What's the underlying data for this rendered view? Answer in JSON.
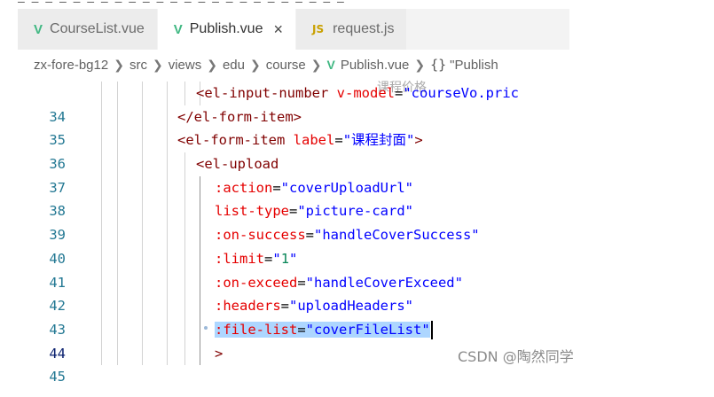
{
  "tabs": [
    {
      "icon": "V",
      "label": "CourseList.vue"
    },
    {
      "icon": "V",
      "label": "Publish.vue",
      "close": "×"
    },
    {
      "icon": "JS",
      "label": "request.js"
    }
  ],
  "breadcrumb": {
    "items": [
      "zx-fore-bg12",
      "src",
      "views",
      "edu",
      "course"
    ],
    "file_icon": "V",
    "file": "Publish.vue",
    "symbol_icon": "{}",
    "symbol": "\"Publish"
  },
  "ghost_text": "课程价格",
  "code": {
    "line_numbers": [
      "34",
      "35",
      "36",
      "37",
      "38",
      "39",
      "40",
      "41",
      "42",
      "43",
      "44",
      "45"
    ],
    "l34": {
      "open": "<",
      "tag": "el-input-number",
      "attr": "v-model",
      "eq": "=",
      "val": "\"courseVo.pric"
    },
    "l35": {
      "close": "</el-form-item>"
    },
    "l36": {
      "open": "<",
      "tag": "el-form-item",
      "attr": "label",
      "eq": "=",
      "val": "\"课程封面\"",
      "end": ">"
    },
    "l37": {
      "open": "<",
      "tag": "el-upload"
    },
    "l38": {
      "attr": ":action",
      "eq": "=",
      "val": "\"coverUploadUrl\""
    },
    "l39": {
      "attr": "list-type",
      "eq": "=",
      "val": "\"picture-card\""
    },
    "l40": {
      "attr": ":on-success",
      "eq": "=",
      "val": "\"handleCoverSuccess\""
    },
    "l41": {
      "attr": ":limit",
      "eq": "=",
      "q1": "\"",
      "num": "1",
      "q2": "\""
    },
    "l42": {
      "attr": ":on-exceed",
      "eq": "=",
      "val": "\"handleCoverExceed\""
    },
    "l43": {
      "attr": ":headers",
      "eq": "=",
      "val": "\"uploadHeaders\""
    },
    "l44": {
      "attr": ":file-list",
      "eq": "=",
      "val": "\"coverFileList\""
    },
    "l45": {
      "end": ">"
    }
  },
  "watermark": "CSDN @陶然同学",
  "colors": {
    "tag": "#800000",
    "attr": "#e50000",
    "string": "#0000ff",
    "number": "#098658",
    "selection": "#add6ff",
    "line_number": "#237893"
  }
}
